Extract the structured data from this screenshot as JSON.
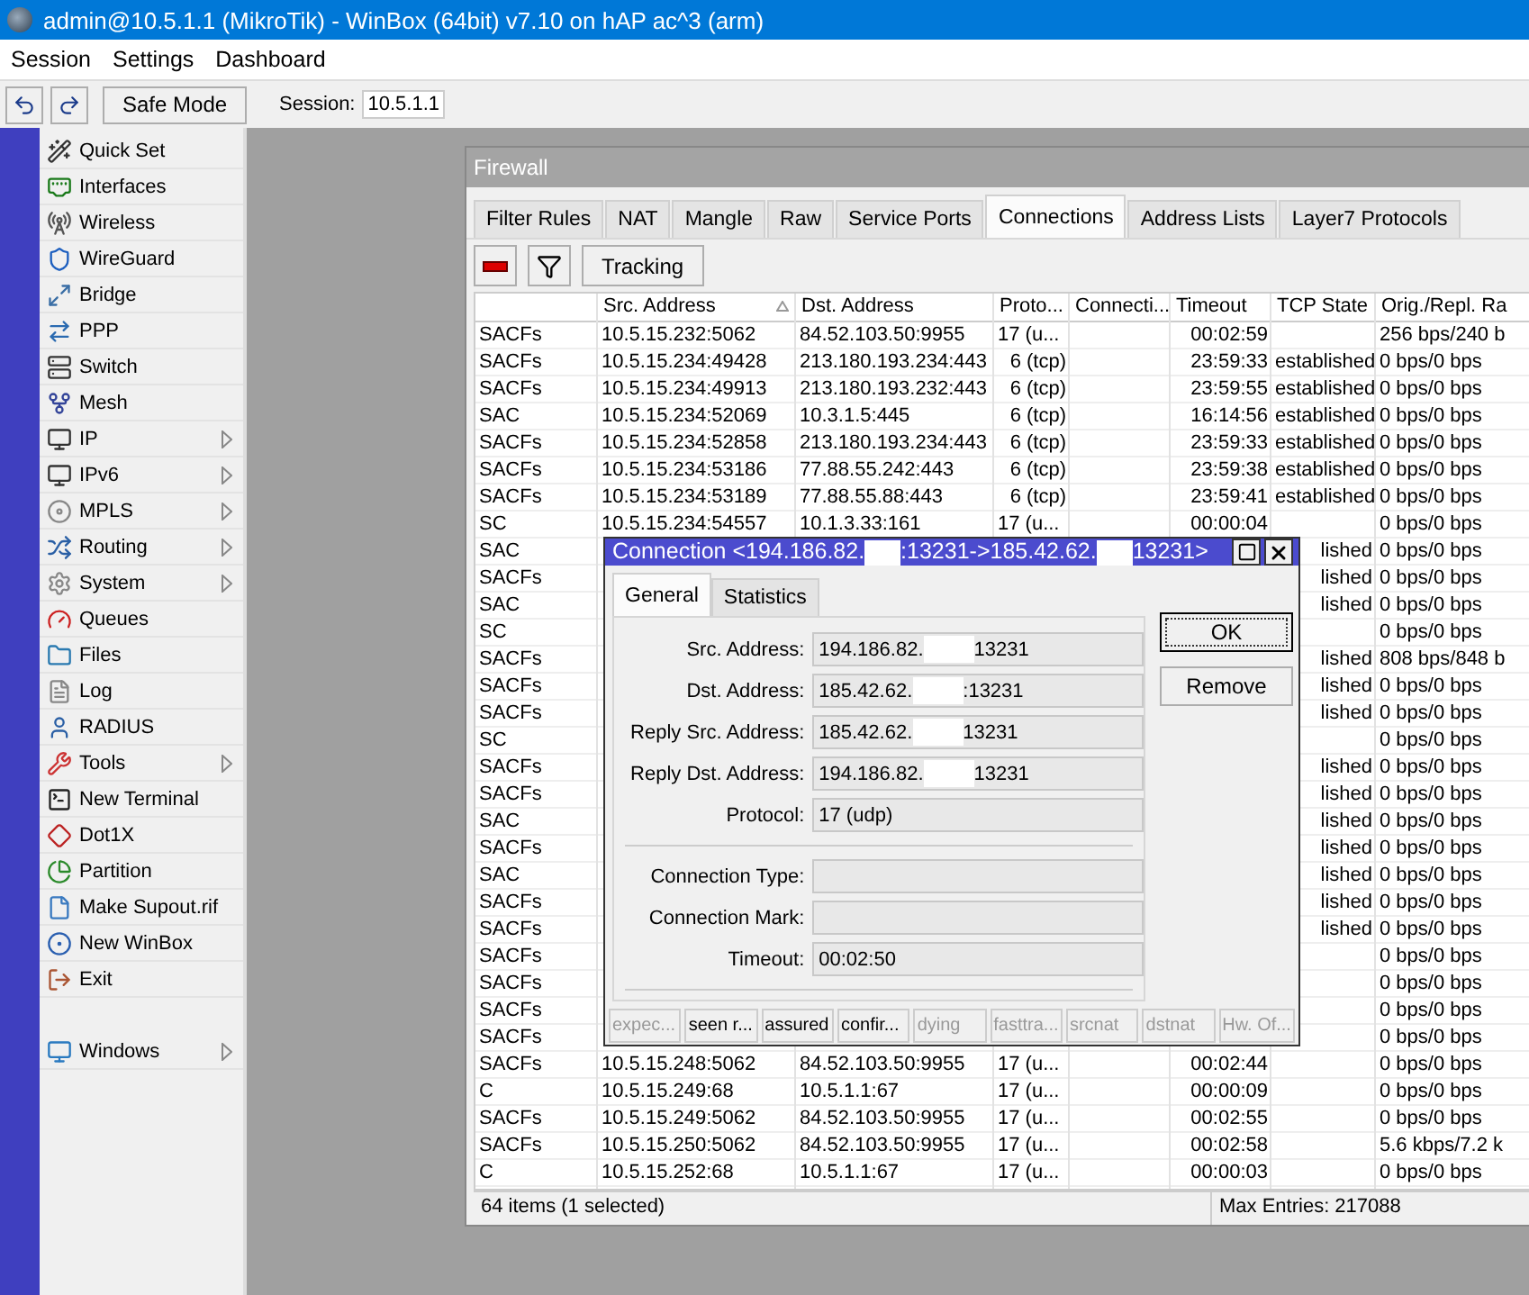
{
  "window": {
    "title": "admin@10.5.1.1 (MikroTik) - WinBox (64bit) v7.10 on hAP ac^3 (arm)"
  },
  "menu": [
    "Session",
    "Settings",
    "Dashboard"
  ],
  "toolbar": {
    "safe_mode": "Safe Mode",
    "session_label": "Session:",
    "session_value": "10.5.1.1"
  },
  "sidebar": {
    "items": [
      {
        "label": "Quick Set",
        "has_submenu": false
      },
      {
        "label": "Interfaces",
        "has_submenu": false
      },
      {
        "label": "Wireless",
        "has_submenu": false
      },
      {
        "label": "WireGuard",
        "has_submenu": false
      },
      {
        "label": "Bridge",
        "has_submenu": false
      },
      {
        "label": "PPP",
        "has_submenu": false
      },
      {
        "label": "Switch",
        "has_submenu": false
      },
      {
        "label": "Mesh",
        "has_submenu": false
      },
      {
        "label": "IP",
        "has_submenu": true
      },
      {
        "label": "IPv6",
        "has_submenu": true
      },
      {
        "label": "MPLS",
        "has_submenu": true
      },
      {
        "label": "Routing",
        "has_submenu": true
      },
      {
        "label": "System",
        "has_submenu": true
      },
      {
        "label": "Queues",
        "has_submenu": false
      },
      {
        "label": "Files",
        "has_submenu": false
      },
      {
        "label": "Log",
        "has_submenu": false
      },
      {
        "label": "RADIUS",
        "has_submenu": false
      },
      {
        "label": "Tools",
        "has_submenu": true
      },
      {
        "label": "New Terminal",
        "has_submenu": false
      },
      {
        "label": "Dot1X",
        "has_submenu": false
      },
      {
        "label": "Partition",
        "has_submenu": false
      },
      {
        "label": "Make Supout.rif",
        "has_submenu": false
      },
      {
        "label": "New WinBox",
        "has_submenu": false
      },
      {
        "label": "Exit",
        "has_submenu": false
      }
    ],
    "bottom_items": [
      {
        "label": "Windows",
        "has_submenu": true
      }
    ]
  },
  "firewall": {
    "title": "Firewall",
    "tabs": [
      {
        "label": "Filter Rules",
        "selected": false
      },
      {
        "label": "NAT",
        "selected": false
      },
      {
        "label": "Mangle",
        "selected": false
      },
      {
        "label": "Raw",
        "selected": false
      },
      {
        "label": "Service Ports",
        "selected": false
      },
      {
        "label": "Connections",
        "selected": true
      },
      {
        "label": "Address Lists",
        "selected": false
      },
      {
        "label": "Layer7 Protocols",
        "selected": false
      }
    ],
    "tracking_button": "Tracking",
    "columns": [
      "",
      "Src. Address",
      "Dst. Address",
      "Proto...",
      "Connecti...",
      "Timeout",
      "TCP State",
      "Orig./Repl. Ra"
    ],
    "rows": [
      {
        "kind": "full",
        "cells": [
          "SACFs",
          "10.5.15.232:5062",
          "84.52.103.50:9955",
          "17 (u...",
          "",
          "00:02:59",
          "",
          "256 bps/240 b"
        ]
      },
      {
        "kind": "full",
        "cells": [
          "SACFs",
          "10.5.15.234:49428",
          "213.180.193.234:443",
          "6 (tcp)",
          "",
          "23:59:33",
          "established",
          "0 bps/0 bps"
        ]
      },
      {
        "kind": "full",
        "cells": [
          "SACFs",
          "10.5.15.234:49913",
          "213.180.193.232:443",
          "6 (tcp)",
          "",
          "23:59:55",
          "established",
          "0 bps/0 bps"
        ]
      },
      {
        "kind": "full",
        "cells": [
          "SAC",
          "10.5.15.234:52069",
          "10.3.1.5:445",
          "6 (tcp)",
          "",
          "16:14:56",
          "established",
          "0 bps/0 bps"
        ]
      },
      {
        "kind": "full",
        "cells": [
          "SACFs",
          "10.5.15.234:52858",
          "213.180.193.234:443",
          "6 (tcp)",
          "",
          "23:59:33",
          "established",
          "0 bps/0 bps"
        ]
      },
      {
        "kind": "full",
        "cells": [
          "SACFs",
          "10.5.15.234:53186",
          "77.88.55.242:443",
          "6 (tcp)",
          "",
          "23:59:38",
          "established",
          "0 bps/0 bps"
        ]
      },
      {
        "kind": "full",
        "cells": [
          "SACFs",
          "10.5.15.234:53189",
          "77.88.55.88:443",
          "6 (tcp)",
          "",
          "23:59:41",
          "established",
          "0 bps/0 bps"
        ]
      },
      {
        "kind": "full",
        "cells": [
          "SC",
          "10.5.15.234:54557",
          "10.1.3.33:161",
          "17 (u...",
          "",
          "00:00:04",
          "",
          "0 bps/0 bps"
        ]
      },
      {
        "kind": "covered",
        "cells": [
          "SAC",
          "",
          "",
          "",
          "",
          "",
          "lished",
          "0 bps/0 bps"
        ]
      },
      {
        "kind": "covered",
        "cells": [
          "SACFs",
          "",
          "",
          "",
          "",
          "",
          "lished",
          "0 bps/0 bps"
        ]
      },
      {
        "kind": "covered",
        "cells": [
          "SAC",
          "",
          "",
          "",
          "",
          "",
          "lished",
          "0 bps/0 bps"
        ]
      },
      {
        "kind": "covered",
        "cells": [
          "SC",
          "",
          "",
          "",
          "",
          "",
          "",
          "0 bps/0 bps"
        ]
      },
      {
        "kind": "covered",
        "cells": [
          "SACFs",
          "",
          "",
          "",
          "",
          "",
          "lished",
          "808 bps/848 b"
        ]
      },
      {
        "kind": "covered",
        "cells": [
          "SACFs",
          "",
          "",
          "",
          "",
          "",
          "lished",
          "0 bps/0 bps"
        ]
      },
      {
        "kind": "covered",
        "cells": [
          "SACFs",
          "",
          "",
          "",
          "",
          "",
          "lished",
          "0 bps/0 bps"
        ]
      },
      {
        "kind": "covered",
        "cells": [
          "SC",
          "",
          "",
          "",
          "",
          "",
          "",
          "0 bps/0 bps"
        ]
      },
      {
        "kind": "covered",
        "cells": [
          "SACFs",
          "",
          "",
          "",
          "",
          "",
          "lished",
          "0 bps/0 bps"
        ]
      },
      {
        "kind": "covered",
        "cells": [
          "SACFs",
          "",
          "",
          "",
          "",
          "",
          "lished",
          "0 bps/0 bps"
        ]
      },
      {
        "kind": "covered",
        "cells": [
          "SAC",
          "",
          "",
          "",
          "",
          "",
          "lished",
          "0 bps/0 bps"
        ]
      },
      {
        "kind": "covered",
        "cells": [
          "SACFs",
          "",
          "",
          "",
          "",
          "",
          "lished",
          "0 bps/0 bps"
        ]
      },
      {
        "kind": "covered",
        "cells": [
          "SAC",
          "",
          "",
          "",
          "",
          "",
          "lished",
          "0 bps/0 bps"
        ]
      },
      {
        "kind": "covered",
        "cells": [
          "SACFs",
          "",
          "",
          "",
          "",
          "",
          "lished",
          "0 bps/0 bps"
        ]
      },
      {
        "kind": "covered",
        "cells": [
          "SACFs",
          "",
          "",
          "",
          "",
          "",
          "lished",
          "0 bps/0 bps"
        ]
      },
      {
        "kind": "covered",
        "cells": [
          "SACFs",
          "",
          "",
          "",
          "",
          "",
          "",
          "0 bps/0 bps"
        ]
      },
      {
        "kind": "covered",
        "cells": [
          "SACFs",
          "",
          "",
          "",
          "",
          "",
          "",
          "0 bps/0 bps"
        ]
      },
      {
        "kind": "covered",
        "cells": [
          "SACFs",
          "",
          "",
          "",
          "",
          "",
          "",
          "0 bps/0 bps"
        ]
      },
      {
        "kind": "covered",
        "cells": [
          "SACFs",
          "",
          "",
          "",
          "",
          "",
          "",
          "0 bps/0 bps"
        ]
      },
      {
        "kind": "full",
        "cells": [
          "SACFs",
          "10.5.15.248:5062",
          "84.52.103.50:9955",
          "17 (u...",
          "",
          "00:02:44",
          "",
          "0 bps/0 bps"
        ]
      },
      {
        "kind": "full",
        "cells": [
          "C",
          "10.5.15.249:68",
          "10.5.1.1:67",
          "17 (u...",
          "",
          "00:00:09",
          "",
          "0 bps/0 bps"
        ]
      },
      {
        "kind": "full",
        "cells": [
          "SACFs",
          "10.5.15.249:5062",
          "84.52.103.50:9955",
          "17 (u...",
          "",
          "00:02:55",
          "",
          "0 bps/0 bps"
        ]
      },
      {
        "kind": "full",
        "cells": [
          "SACFs",
          "10.5.15.250:5062",
          "84.52.103.50:9955",
          "17 (u...",
          "",
          "00:02:58",
          "",
          "5.6 kbps/7.2 k"
        ]
      },
      {
        "kind": "full",
        "cells": [
          "C",
          "10.5.15.252:68",
          "10.5.1.1:67",
          "17 (u...",
          "",
          "00:00:03",
          "",
          "0 bps/0 bps"
        ]
      }
    ],
    "status": [
      "64 items (1 selected)",
      "Max Entries: 217088"
    ]
  },
  "dialog": {
    "title_parts": [
      "Connection <194.186.82.",
      ":13231->185.42.62.",
      "13231>"
    ],
    "tabs": [
      {
        "label": "General",
        "selected": true
      },
      {
        "label": "Statistics",
        "selected": false
      }
    ],
    "field_groups": [
      [
        {
          "label": "Src. Address:",
          "parts": [
            "194.186.82.",
            "13231"
          ]
        },
        {
          "label": "Dst. Address:",
          "parts": [
            "185.42.62.",
            ":13231"
          ]
        },
        {
          "label": "Reply Src. Address:",
          "parts": [
            "185.42.62.",
            "13231"
          ]
        },
        {
          "label": "Reply Dst. Address:",
          "parts": [
            "194.186.82.",
            "13231"
          ]
        },
        {
          "label": "Protocol:",
          "parts": [
            "17 (udp)"
          ]
        }
      ],
      [
        {
          "label": "Connection Type:"
        },
        {
          "label": "Connection Mark:"
        },
        {
          "label": "Timeout:",
          "parts": [
            "00:02:50"
          ]
        }
      ]
    ],
    "buttons": [
      "OK",
      "Remove"
    ],
    "flags": [
      {
        "label": "expec...",
        "active": false
      },
      {
        "label": "seen r...",
        "active": true
      },
      {
        "label": "assured",
        "active": true
      },
      {
        "label": "confir...",
        "active": true
      },
      {
        "label": "dying",
        "active": false
      },
      {
        "label": "fasttra...",
        "active": false
      },
      {
        "label": "srcnat",
        "active": false
      },
      {
        "label": "dstnat",
        "active": false
      },
      {
        "label": "Hw. Of...",
        "active": false
      }
    ]
  }
}
